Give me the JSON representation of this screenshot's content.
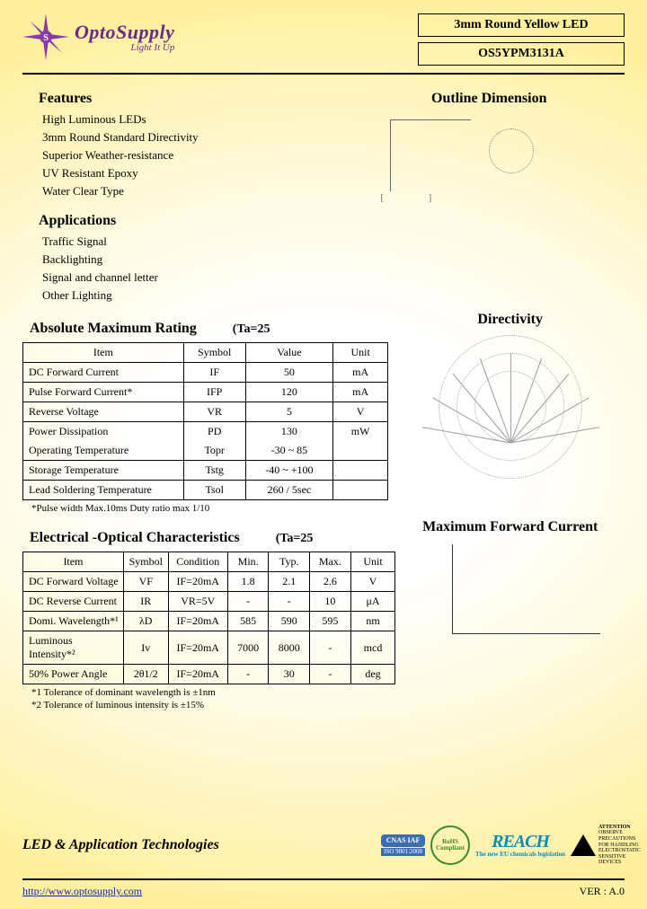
{
  "header": {
    "brand": "OptoSupply",
    "tagline": "Light It Up",
    "product_line": "3mm Round Yellow LED",
    "part_number": "OS5YPM3131A"
  },
  "features": {
    "heading": "Features",
    "items": [
      "High Luminous LEDs",
      "3mm Round Standard Directivity",
      "Superior Weather-resistance",
      "UV Resistant Epoxy",
      "Water Clear Type"
    ]
  },
  "outline": {
    "heading": "Outline Dimension"
  },
  "applications": {
    "heading": "Applications",
    "items": [
      "Traffic Signal",
      "Backlighting",
      "Signal and channel letter",
      "Other Lighting"
    ]
  },
  "abs_max": {
    "heading": "Absolute Maximum Rating",
    "condition": "(Ta=25",
    "cols": [
      "Item",
      "Symbol",
      "Value",
      "Unit"
    ],
    "rows": [
      {
        "item": "DC Forward Current",
        "sym": "IF",
        "val": "50",
        "unit": "mA"
      },
      {
        "item": "Pulse Forward Current*",
        "sym": "IFP",
        "val": "120",
        "unit": "mA"
      },
      {
        "item": "Reverse Voltage",
        "sym": "VR",
        "val": "5",
        "unit": "V"
      },
      {
        "item": "Power Dissipation",
        "sym": "PD",
        "val": "130",
        "unit": "mW"
      },
      {
        "item": "Operating Temperature",
        "sym": "Topr",
        "val": "-30 ~ 85",
        "unit": ""
      },
      {
        "item": "Storage Temperature",
        "sym": "Tstg",
        "val": "-40 ~ +100",
        "unit": ""
      },
      {
        "item": "Lead Soldering Temperature",
        "sym": "Tsol",
        "val": "260 / 5sec",
        "unit": ""
      }
    ],
    "footnote": "*Pulse width Max.10ms Duty ratio max 1/10"
  },
  "directivity": {
    "heading": "Directivity"
  },
  "elec_opt": {
    "heading": "Electrical -Optical Characteristics",
    "condition": "(Ta=25",
    "cols": [
      "Item",
      "Symbol",
      "Condition",
      "Min.",
      "Typ.",
      "Max.",
      "Unit"
    ],
    "rows": [
      {
        "item": "DC Forward Voltage",
        "sym": "VF",
        "cond": "IF=20mA",
        "min": "1.8",
        "typ": "2.1",
        "max": "2.6",
        "unit": "V"
      },
      {
        "item": "DC Reverse Current",
        "sym": "IR",
        "cond": "VR=5V",
        "min": "-",
        "typ": "-",
        "max": "10",
        "unit": "μA"
      },
      {
        "item": "Domi. Wavelength*¹",
        "sym": "λD",
        "cond": "IF=20mA",
        "min": "585",
        "typ": "590",
        "max": "595",
        "unit": "nm"
      },
      {
        "item": "Luminous Intensity*²",
        "sym": "Iv",
        "cond": "IF=20mA",
        "min": "7000",
        "typ": "8000",
        "max": "-",
        "unit": "mcd"
      },
      {
        "item": "50% Power Angle",
        "sym": "2θ1/2",
        "cond": "IF=20mA",
        "min": "-",
        "typ": "30",
        "max": "-",
        "unit": "deg"
      }
    ],
    "foot1": "*1 Tolerance of dominant wavelength is ±1nm",
    "foot2": "*2 Tolerance of luminous intensity is ±15%"
  },
  "mfc": {
    "heading": "Maximum Forward Current"
  },
  "footer": {
    "title": "LED & Application Technologies",
    "cnas": "CNAS  IAF",
    "iso": "ISO 9001:2008",
    "rohs": "RoHS Compliant",
    "reach_big": "REACH",
    "reach_sm": "The new EU chemicals legislation",
    "esd_title": "ATTENTION",
    "esd_txt": "OBSERVE PRECAUTIONS FOR HANDLING ELECTROSTATIC SENSITIVE DEVICES"
  },
  "bottom": {
    "url": "http://www.optosupply.com",
    "ver": "VER : A.0"
  }
}
